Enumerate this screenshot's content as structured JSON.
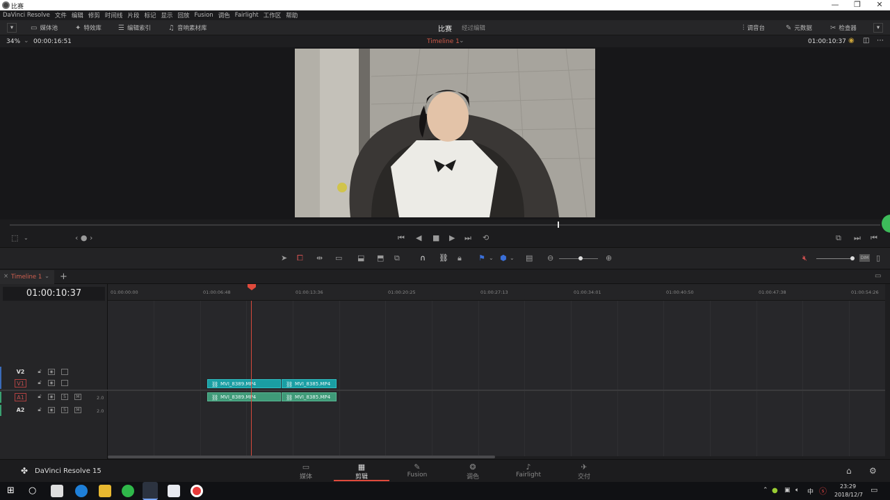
{
  "window": {
    "title": "比赛",
    "min": "—",
    "max": "❐",
    "close": "✕"
  },
  "menu": [
    "DaVinci Resolve",
    "文件",
    "编辑",
    "修剪",
    "时间线",
    "片段",
    "标记",
    "显示",
    "回放",
    "Fusion",
    "调色",
    "Fairlight",
    "工作区",
    "帮助"
  ],
  "toolbar": {
    "media_pool": "媒体池",
    "effects": "特效库",
    "edit_index": "编辑索引",
    "sound_library": "音响素材库",
    "project_name": "比赛",
    "project_status": "经过编辑",
    "mixer": "调音台",
    "metadata": "元数据",
    "inspector": "检查器"
  },
  "viewer": {
    "zoom": "34%",
    "source_tc": "00:00:16:51",
    "timeline_name": "Timeline 1",
    "record_tc": "01:00:10:37"
  },
  "timeline": {
    "tab_label": "Timeline 1",
    "timecode": "01:00:10:37",
    "ruler": [
      "01:00:00:00",
      "01:00:06:48",
      "01:00:13:36",
      "01:00:20:25",
      "01:00:27:13",
      "01:00:34:01",
      "01:00:40:50",
      "01:00:47:38",
      "01:00:54:26"
    ],
    "tracks": [
      {
        "name": "V2",
        "type": "video"
      },
      {
        "name": "V1",
        "type": "video"
      },
      {
        "name": "A1",
        "type": "audio",
        "level": "2.0"
      },
      {
        "name": "A2",
        "type": "audio",
        "level": "2.0"
      }
    ],
    "clips": {
      "v1a": "MVI_8389.MP4",
      "v1b": "MVI_8385.MP4",
      "a1a": "MVI_8389.MP4",
      "a1b": "MVI_8385.MP4"
    },
    "solo": "S",
    "mute": "M"
  },
  "footer": {
    "app": "DaVinci Resolve 15",
    "pages": [
      "媒体",
      "剪辑",
      "Fusion",
      "调色",
      "Fairlight",
      "交付"
    ],
    "active_page": "剪辑"
  },
  "taskbar": {
    "time": "23:29",
    "date": "2018/12/7",
    "ime": "中"
  },
  "colors": {
    "accent_red": "#e04a3c",
    "clip_video": "#1a9ea3",
    "clip_audio": "#3f9a78"
  }
}
